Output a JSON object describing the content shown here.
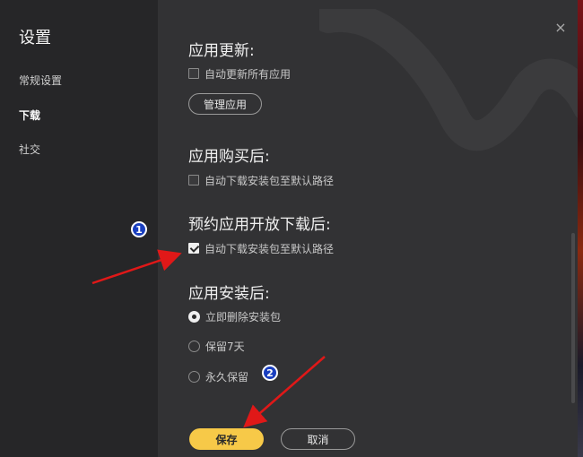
{
  "sidebar": {
    "title": "设置",
    "items": [
      {
        "label": "常规设置"
      },
      {
        "label": "下载"
      },
      {
        "label": "社交"
      }
    ]
  },
  "window": {
    "close_icon": "×"
  },
  "sections": {
    "app_update": {
      "title": "应用更新:",
      "option": "自动更新所有应用",
      "option_checked": false,
      "manage_button": "管理应用"
    },
    "after_purchase": {
      "title": "应用购买后:",
      "option": "自动下载安装包至默认路径",
      "option_checked": false
    },
    "after_preorder": {
      "title": "预约应用开放下载后:",
      "option": "自动下载安装包至默认路径",
      "option_checked": true
    },
    "after_install": {
      "title": "应用安装后:",
      "options": [
        {
          "label": "立即删除安装包",
          "checked": true
        },
        {
          "label": "保留7天",
          "checked": false
        },
        {
          "label": "永久保留",
          "checked": false
        }
      ]
    }
  },
  "footer": {
    "save": "保存",
    "cancel": "取消"
  },
  "annotations": {
    "badge1": "1",
    "badge2": "2"
  },
  "colors": {
    "accent": "#f7c948",
    "annotation_arrow": "#e01818",
    "badge": "#1a3fbf"
  }
}
